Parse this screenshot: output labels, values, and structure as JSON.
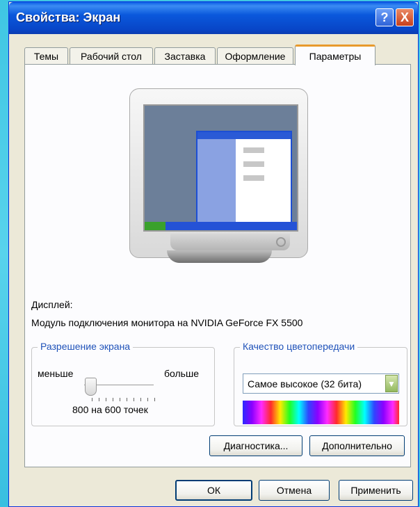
{
  "window": {
    "title": "Свойства: Экран"
  },
  "title_buttons": {
    "help": "?",
    "close": "X"
  },
  "tabs": [
    {
      "label": "Темы"
    },
    {
      "label": "Рабочий стол"
    },
    {
      "label": "Заставка"
    },
    {
      "label": "Оформление"
    },
    {
      "label": "Параметры"
    }
  ],
  "display": {
    "label": "Дисплей:",
    "device": "Модуль подключения монитора на NVIDIA GeForce FX 5500"
  },
  "resolution": {
    "legend": "Разрешение экрана",
    "less": "меньше",
    "more": "больше",
    "value": "800 на 600 точек",
    "slider_level": 0.1
  },
  "color_quality": {
    "legend": "Качество цветопередачи",
    "selected": "Самое высокое (32 бита)"
  },
  "buttons": {
    "diagnostics": "Диагностика...",
    "advanced": "Дополнительно",
    "ok": "ОК",
    "cancel": "Отмена",
    "apply": "Применить"
  },
  "colors": {
    "titlebar": "#0a5de4",
    "tab_accent": "#e89a2c",
    "close_button": "#c8401c",
    "legend_text": "#1f52b9"
  }
}
